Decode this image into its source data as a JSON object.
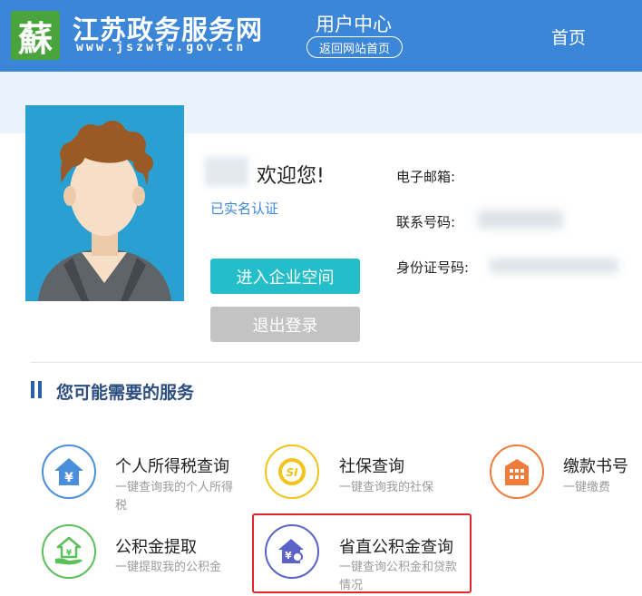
{
  "header": {
    "logo_char": "蘇",
    "site_title": "江苏政务服务网",
    "site_url": "www.jszwfw.gov.cn",
    "center_title": "用户中心",
    "back_label": "返回网站首页",
    "home_label": "首页"
  },
  "profile": {
    "welcome": "欢迎您!",
    "verified": "已实名认证",
    "enter_enterprise": "进入企业空间",
    "logout": "退出登录",
    "email_label": "电子邮箱:",
    "phone_label": "联系号码:",
    "id_label": "身份证号码:"
  },
  "services": {
    "section_title": "您可能需要的服务",
    "items": [
      {
        "title": "个人所得税查询",
        "desc": "一键查询我的个人所得税",
        "icon": "tax-house-yuan-icon",
        "color": "#4a8fdc"
      },
      {
        "title": "社保查询",
        "desc": "一键查询我的社保",
        "icon": "social-security-si-icon",
        "color": "#f0c419"
      },
      {
        "title": "缴款书号",
        "desc": "一键缴费",
        "icon": "building-icon",
        "color": "#f07c3c"
      },
      {
        "title": "公积金提取",
        "desc": "一键提取我的公积金",
        "icon": "house-hand-icon",
        "color": "#5cc05a"
      },
      {
        "title": "省直公积金查询",
        "desc": "一键查询公积金和贷款情况",
        "icon": "house-search-icon",
        "color": "#5a63c8"
      }
    ]
  }
}
